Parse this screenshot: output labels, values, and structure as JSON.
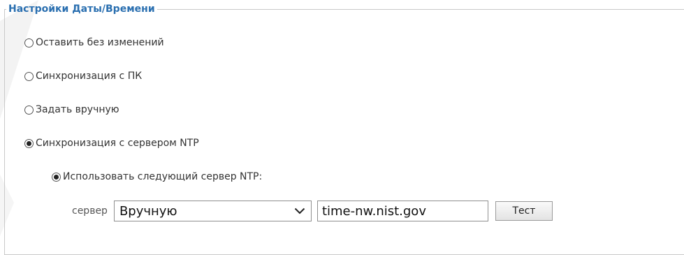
{
  "section": {
    "title": "Настройки Даты/Времени"
  },
  "options": [
    {
      "label": "Оставить без изменений",
      "checked": false
    },
    {
      "label": "Синхронизация с ПК",
      "checked": false
    },
    {
      "label": "Задать вручную",
      "checked": false
    },
    {
      "label": "Синхронизация с сервером NTP",
      "checked": true
    }
  ],
  "ntp": {
    "use_server_label": "Использовать следующий сервер NTP:",
    "use_server_checked": true,
    "server_label": "сервер",
    "server_select_value": "Вручную",
    "server_input_value": "time-nw.nist.gov",
    "test_button_label": "Тест"
  }
}
